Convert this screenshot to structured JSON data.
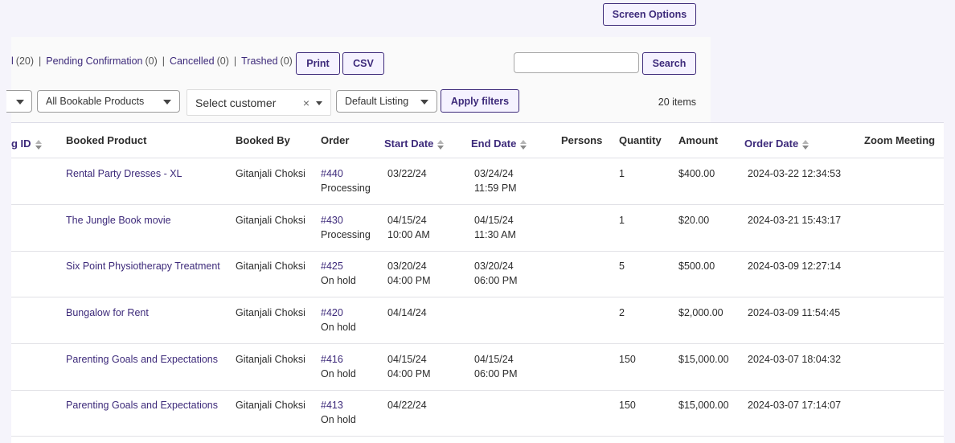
{
  "header": {
    "screen_options_label": "Screen Options"
  },
  "status_links": [
    {
      "label": "l",
      "count": "(20)"
    },
    {
      "label": "Pending Confirmation",
      "count": "(0)"
    },
    {
      "label": "Cancelled",
      "count": "(0)"
    },
    {
      "label": "Trashed",
      "count": "(0)"
    }
  ],
  "toolbar": {
    "print_label": "Print",
    "csv_label": "CSV",
    "search_value": "",
    "search_placeholder": "",
    "search_label": "Search",
    "apply_filters_label": "Apply filters",
    "items_count": "20 items"
  },
  "filters": {
    "first_value": "",
    "products_value": "All Bookable Products",
    "customer_placeholder": "Select customer",
    "customer_clear": "×",
    "listing_value": "Default Listing"
  },
  "table": {
    "columns": [
      {
        "label": "g ID",
        "sortable": true
      },
      {
        "label": "Booked Product",
        "sortable": false
      },
      {
        "label": "Booked By",
        "sortable": false
      },
      {
        "label": "Order",
        "sortable": false
      },
      {
        "label": "Start Date",
        "sortable": true
      },
      {
        "label": "End Date",
        "sortable": true
      },
      {
        "label": "Persons",
        "sortable": false
      },
      {
        "label": "Quantity",
        "sortable": false
      },
      {
        "label": "Amount",
        "sortable": false
      },
      {
        "label": "Order Date",
        "sortable": true
      },
      {
        "label": "Zoom Meeting",
        "sortable": false
      }
    ],
    "rows": [
      {
        "product": "Rental Party Dresses - XL",
        "booked_by": "Gitanjali Choksi",
        "order": "#440",
        "order_status": "Processing",
        "start_date": "03/22/24",
        "start_time": "",
        "end_date": "03/24/24",
        "end_time": "11:59 PM",
        "persons": "",
        "quantity": "1",
        "amount": "$400.00",
        "order_date": "2024-03-22 12:34:53",
        "zoom": ""
      },
      {
        "product": "The Jungle Book movie",
        "booked_by": "Gitanjali Choksi",
        "order": "#430",
        "order_status": "Processing",
        "start_date": "04/15/24",
        "start_time": "10:00 AM",
        "end_date": "04/15/24",
        "end_time": "11:30 AM",
        "persons": "",
        "quantity": "1",
        "amount": "$20.00",
        "order_date": "2024-03-21 15:43:17",
        "zoom": ""
      },
      {
        "product": "Six Point Physiotherapy Treatment",
        "booked_by": "Gitanjali Choksi",
        "order": "#425",
        "order_status": "On hold",
        "start_date": "03/20/24",
        "start_time": "04:00 PM",
        "end_date": "03/20/24",
        "end_time": "06:00 PM",
        "persons": "",
        "quantity": "5",
        "amount": "$500.00",
        "order_date": "2024-03-09 12:27:14",
        "zoom": ""
      },
      {
        "product": "Bungalow for Rent",
        "booked_by": "Gitanjali Choksi",
        "order": "#420",
        "order_status": "On hold",
        "start_date": "04/14/24",
        "start_time": "",
        "end_date": "",
        "end_time": "",
        "persons": "",
        "quantity": "2",
        "amount": "$2,000.00",
        "order_date": "2024-03-09 11:54:45",
        "zoom": ""
      },
      {
        "product": "Parenting Goals and Expectations",
        "booked_by": "Gitanjali Choksi",
        "order": "#416",
        "order_status": "On hold",
        "start_date": "04/15/24",
        "start_time": "04:00 PM",
        "end_date": "04/15/24",
        "end_time": "06:00 PM",
        "persons": "",
        "quantity": "150",
        "amount": "$15,000.00",
        "order_date": "2024-03-07 18:04:32",
        "zoom": ""
      },
      {
        "product": "Parenting Goals and Expectations",
        "booked_by": "Gitanjali Choksi",
        "order": "#413",
        "order_status": "On hold",
        "start_date": "04/22/24",
        "start_time": "",
        "end_date": "",
        "end_time": "",
        "persons": "",
        "quantity": "150",
        "amount": "$15,000.00",
        "order_date": "2024-03-07 17:14:07",
        "zoom": ""
      }
    ]
  },
  "colors": {
    "accent": "#3d2a7a",
    "page_bg": "#f5f4fb",
    "panel_bg": "#fafafa",
    "button_bg": "#f5f2ff"
  }
}
